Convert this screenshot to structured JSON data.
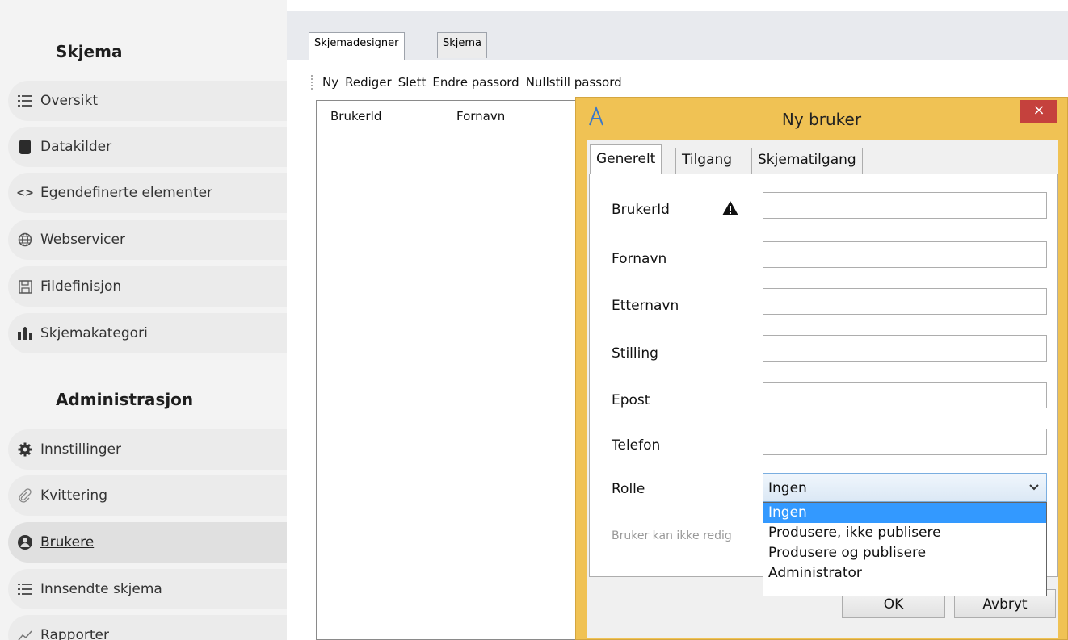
{
  "sidebar": {
    "section1_title": "Skjema",
    "section2_title": "Administrasjon",
    "items": [
      {
        "label": "Oversikt",
        "icon": "list-icon"
      },
      {
        "label": "Datakilder",
        "icon": "database-icon"
      },
      {
        "label": "Egendefinerte elementer",
        "icon": "code-icon"
      },
      {
        "label": "Webservicer",
        "icon": "globe-icon"
      },
      {
        "label": "Fildefinisjon",
        "icon": "save-icon"
      },
      {
        "label": "Skjemakategori",
        "icon": "category-icon"
      },
      {
        "label": "Innstillinger",
        "icon": "gear-icon"
      },
      {
        "label": "Kvittering",
        "icon": "paperclip-icon"
      },
      {
        "label": "Brukere",
        "icon": "user-icon",
        "active": true
      },
      {
        "label": "Innsendte skjema",
        "icon": "list-icon"
      },
      {
        "label": "Rapporter",
        "icon": "chart-icon"
      }
    ]
  },
  "main": {
    "tabs": [
      "Skjemadesigner",
      "Skjema"
    ],
    "toolbar": [
      "Ny",
      "Rediger",
      "Slett",
      "Endre passord",
      "Nullstill passord"
    ],
    "columns": [
      "BrukerId",
      "Fornavn"
    ]
  },
  "dialog": {
    "title": "Ny bruker",
    "close": "×",
    "tabs": [
      "Generelt",
      "Tilgang",
      "Skjematilgang"
    ],
    "fields": {
      "brukerid": {
        "label": "BrukerId",
        "value": ""
      },
      "fornavn": {
        "label": "Fornavn",
        "value": ""
      },
      "etternavn": {
        "label": "Etternavn",
        "value": ""
      },
      "stilling": {
        "label": "Stilling",
        "value": ""
      },
      "epost": {
        "label": "Epost",
        "value": ""
      },
      "telefon": {
        "label": "Telefon",
        "value": ""
      }
    },
    "role": {
      "label": "Rolle",
      "selected": "Ingen",
      "options": [
        "Ingen",
        "Produsere, ikke publisere",
        "Produsere og publisere",
        "Administrator"
      ]
    },
    "hint": "Bruker kan ikke redig",
    "ok_label": "OK",
    "cancel_label": "Avbryt"
  },
  "colors": {
    "dialog_frame": "#f0c254",
    "close_button": "#c5413d",
    "selection": "#3399ff"
  }
}
